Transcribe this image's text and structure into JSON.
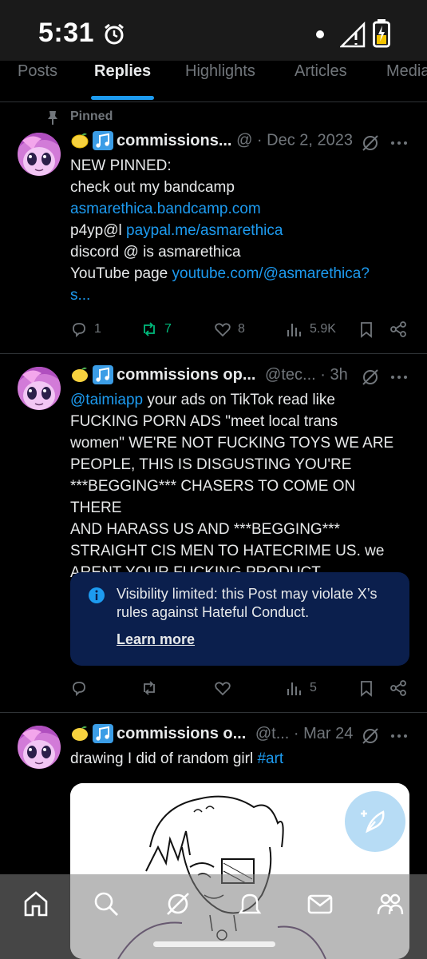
{
  "status_bar": {
    "time": "5:31"
  },
  "tabs": [
    {
      "label": "Posts",
      "active": false
    },
    {
      "label": "Replies",
      "active": true
    },
    {
      "label": "Highlights",
      "active": false
    },
    {
      "label": "Articles",
      "active": false
    },
    {
      "label": "Media",
      "active": false
    }
  ],
  "posts": [
    {
      "pinned_label": "Pinned",
      "name": "commissions...",
      "handle_meta": "@ · Dec 2, 2023",
      "lines": [
        {
          "plain": "NEW PINNED:",
          "link": ""
        },
        {
          "plain": "check out my bandcamp",
          "link": ""
        },
        {
          "plain": "",
          "link": "asmarethica.bandcamp.com"
        },
        {
          "plain": "p4yp@l ",
          "link": "paypal.me/asmarethica"
        },
        {
          "plain": "discord @ is asmarethica",
          "link": ""
        },
        {
          "plain": "YouTube page ",
          "link": "youtube.com/@asmarethica?"
        },
        {
          "plain": "",
          "link": "s..."
        }
      ],
      "replies": "1",
      "reposts": "7",
      "likes": "8",
      "views": "5.9K"
    },
    {
      "name": "commissions op...",
      "handle_meta": "@tec... · 3h",
      "mention": "@taimiapp",
      "text_lines": [
        " your ads on TikTok read like",
        "FUCKING PORN ADS \"meet local trans",
        "women\" WE'RE NOT FUCKING TOYS WE ARE",
        "PEOPLE, THIS IS DISGUSTING YOU'RE",
        "***BEGGING*** CHASERS TO COME ON THERE",
        "AND HARASS US AND ***BEGGING***",
        "STRAIGHT CIS MEN TO HATECRIME US.  we",
        "ARENT YOUR FUCKING PRODUCT"
      ],
      "notice": {
        "text": "Visibility limited: this Post may violate X’s rules against Hateful Conduct.",
        "link_label": "Learn more"
      },
      "views": "5"
    },
    {
      "name": "commissions o...",
      "handle_meta": "@t... · Mar 24",
      "text": "drawing I did of random girl ",
      "hashtag": "#art"
    }
  ],
  "colors": {
    "accent": "#1d9bf0",
    "repost_green": "#00ba7c",
    "muted": "#71767b",
    "notice_bg": "#0b1f4d"
  },
  "icons": [
    "alarm-icon",
    "signal-icon",
    "battery-icon",
    "pin-icon",
    "grok-icon",
    "more-icon",
    "reply-icon",
    "repost-icon",
    "like-icon",
    "views-icon",
    "bookmark-icon",
    "share-icon",
    "info-icon",
    "compose-icon",
    "home-icon",
    "search-icon",
    "grok-nav-icon",
    "notifications-icon",
    "messages-icon",
    "communities-icon"
  ]
}
